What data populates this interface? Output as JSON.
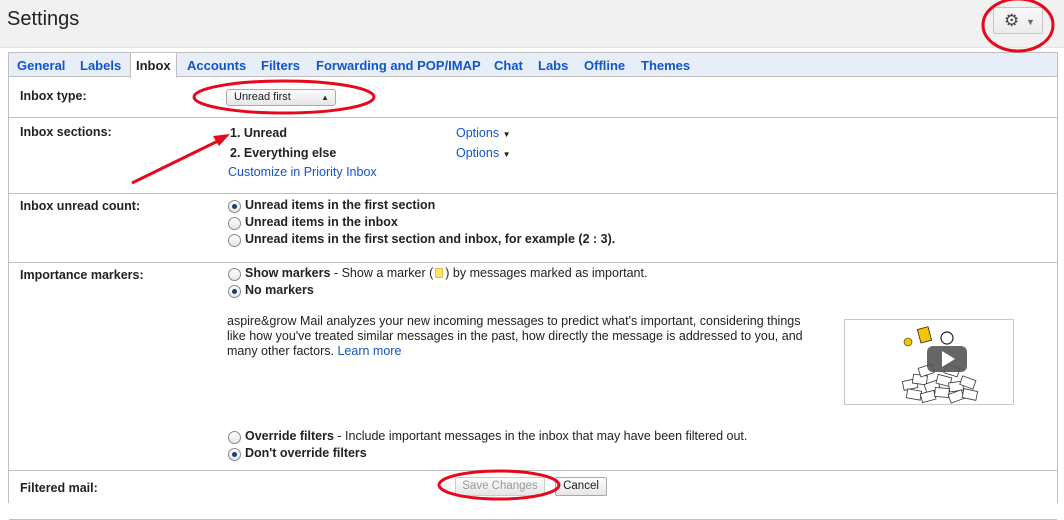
{
  "header": {
    "title": "Settings"
  },
  "tabs": [
    {
      "label": "General",
      "active": false
    },
    {
      "label": "Labels",
      "active": false
    },
    {
      "label": "Inbox",
      "active": true
    },
    {
      "label": "Accounts",
      "active": false
    },
    {
      "label": "Filters",
      "active": false
    },
    {
      "label": "Forwarding and POP/IMAP",
      "active": false
    },
    {
      "label": "Chat",
      "active": false
    },
    {
      "label": "Labs",
      "active": false
    },
    {
      "label": "Offline",
      "active": false
    },
    {
      "label": "Themes",
      "active": false
    }
  ],
  "inbox_type": {
    "label": "Inbox type:",
    "selected": "Unread first"
  },
  "inbox_sections": {
    "label": "Inbox sections:",
    "items": [
      {
        "name": "1. Unread",
        "options": "Options"
      },
      {
        "name": "2. Everything else",
        "options": "Options"
      }
    ],
    "customize_link": "Customize in Priority Inbox"
  },
  "unread_count": {
    "label": "Inbox unread count:",
    "options": [
      {
        "label": "Unread items in the first section",
        "selected": true
      },
      {
        "label": "Unread items in the inbox",
        "selected": false
      },
      {
        "label": "Unread items in the first section and inbox, for example (2 : 3).",
        "selected": false
      }
    ]
  },
  "importance": {
    "label": "Importance markers:",
    "show_markers": "Show markers",
    "show_markers_desc_a": " - Show a marker (",
    "show_markers_desc_b": ") by messages marked as important.",
    "no_markers": "No markers",
    "selected": "No markers",
    "description": "aspire&grow Mail analyzes your new incoming messages to predict what's important, considering things like how you've treated similar messages in the past, how directly the message is addressed to you, and many other factors.",
    "learn_more": "Learn more"
  },
  "filtered": {
    "label": "Filtered mail:",
    "override": "Override filters",
    "override_desc": " - Include important messages in the inbox that may have been filtered out.",
    "dont_override": "Don't override filters",
    "selected": "Don't override filters"
  },
  "footer": {
    "save_label": "Save Changes",
    "cancel_label": "Cancel"
  },
  "colors": {
    "link": "#1155cc",
    "annotation": "#e8081c",
    "tab_bar": "#e8eef7"
  },
  "icons": [
    "settings-gear-icon",
    "chevron-down-icon",
    "sort-arrows-icon",
    "important-marker-icon",
    "video-play-icon"
  ]
}
